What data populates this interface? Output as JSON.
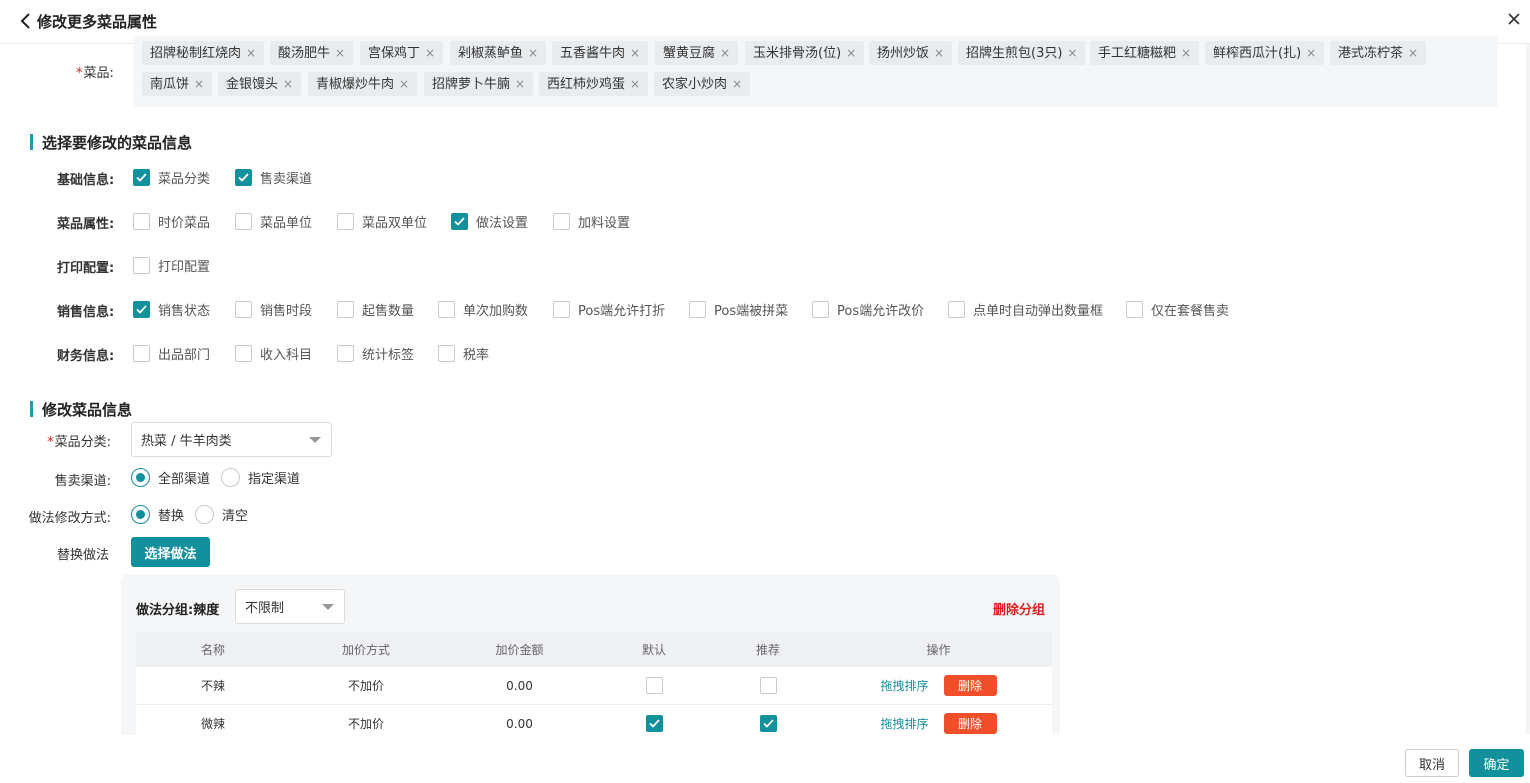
{
  "header": {
    "title": "修改更多菜品属性"
  },
  "dishes": {
    "label": "菜品:",
    "required_mark": "*",
    "tags": [
      "招牌秘制红烧肉",
      "酸汤肥牛",
      "宫保鸡丁",
      "剁椒蒸鲈鱼",
      "五香酱牛肉",
      "蟹黄豆腐",
      "玉米排骨汤(位)",
      "扬州炒饭",
      "招牌生煎包(3只)",
      "手工红糖糍粑",
      "鲜榨西瓜汁(扎)",
      "港式冻柠茶",
      "南瓜饼",
      "金银馒头",
      "青椒爆炒牛肉",
      "招牌萝卜牛腩",
      "西红柿炒鸡蛋",
      "农家小炒肉"
    ],
    "remove_glyph": "×"
  },
  "select_section": {
    "title": "选择要修改的菜品信息",
    "rows": [
      {
        "label": "基础信息:",
        "items": [
          {
            "label": "菜品分类",
            "checked": true
          },
          {
            "label": "售卖渠道",
            "checked": true
          }
        ]
      },
      {
        "label": "菜品属性:",
        "items": [
          {
            "label": "时价菜品",
            "checked": false
          },
          {
            "label": "菜品单位",
            "checked": false
          },
          {
            "label": "菜品双单位",
            "checked": false
          },
          {
            "label": "做法设置",
            "checked": true
          },
          {
            "label": "加料设置",
            "checked": false
          }
        ]
      },
      {
        "label": "打印配置:",
        "items": [
          {
            "label": "打印配置",
            "checked": false
          }
        ]
      },
      {
        "label": "销售信息:",
        "items": [
          {
            "label": "销售状态",
            "checked": true
          },
          {
            "label": "销售时段",
            "checked": false
          },
          {
            "label": "起售数量",
            "checked": false
          },
          {
            "label": "单次加购数",
            "checked": false
          },
          {
            "label": "Pos端允许打折",
            "checked": false
          },
          {
            "label": "Pos端被拼菜",
            "checked": false
          },
          {
            "label": "Pos端允许改价",
            "checked": false
          },
          {
            "label": "点单时自动弹出数量框",
            "checked": false
          },
          {
            "label": "仅在套餐售卖",
            "checked": false
          }
        ]
      },
      {
        "label": "财务信息:",
        "items": [
          {
            "label": "出品部门",
            "checked": false
          },
          {
            "label": "收入科目",
            "checked": false
          },
          {
            "label": "统计标签",
            "checked": false
          },
          {
            "label": "税率",
            "checked": false
          }
        ]
      }
    ]
  },
  "edit_section": {
    "title": "修改菜品信息",
    "category": {
      "label": "菜品分类:",
      "required_mark": "*",
      "value": "热菜 / 牛羊肉类"
    },
    "channel": {
      "label": "售卖渠道:",
      "options": [
        {
          "label": "全部渠道",
          "selected": true
        },
        {
          "label": "指定渠道",
          "selected": false
        }
      ]
    },
    "method_mode": {
      "label": "做法修改方式:",
      "options": [
        {
          "label": "替换",
          "selected": true
        },
        {
          "label": "清空",
          "selected": false
        }
      ]
    },
    "replace": {
      "label": "替换做法",
      "button": "选择做法"
    }
  },
  "method_group": {
    "group_label": "做法分组:",
    "group_name": "辣度",
    "limit_value": "不限制",
    "delete_group": "删除分组",
    "columns": [
      "名称",
      "加价方式",
      "加价金额",
      "默认",
      "推荐",
      "操作"
    ],
    "rows": [
      {
        "name": "不辣",
        "price_mode": "不加价",
        "amount": "0.00",
        "default": false,
        "recommend": false
      },
      {
        "name": "微辣",
        "price_mode": "不加价",
        "amount": "0.00",
        "default": true,
        "recommend": true
      }
    ],
    "drag_label": "拖拽排序",
    "delete_label": "删除"
  },
  "footer": {
    "cancel": "取消",
    "confirm": "确定"
  },
  "colors": {
    "accent": "#12909c",
    "danger": "#e02020",
    "delete_button": "#f04f2a"
  },
  "icons": {
    "back": "chevron-left-icon",
    "close": "close-icon",
    "check": "check-icon",
    "dropdown": "caret-down-icon"
  }
}
